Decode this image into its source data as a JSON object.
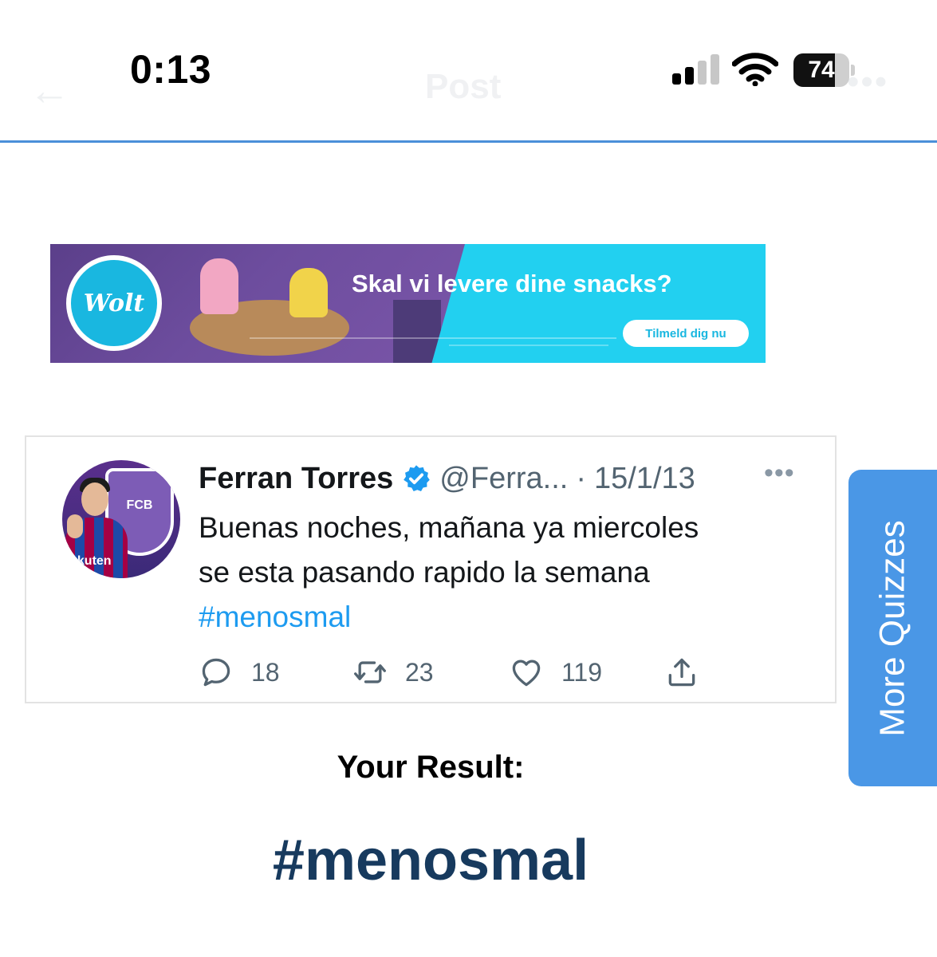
{
  "status_bar": {
    "time": "0:13",
    "battery_level": "74",
    "battery_fraction": 0.74
  },
  "header": {
    "back_icon": "arrow-left-icon",
    "title": "Post",
    "more_icon": "ellipsis-icon",
    "divider_color": "#4a90d9"
  },
  "ad": {
    "brand": "Wolt",
    "headline": "Skal vi levere dine snacks?",
    "cta": "Tilmeld dig nu",
    "accent_color": "#22d0f0"
  },
  "tweet": {
    "author_name": "Ferran Torres",
    "handle": "@Ferra...",
    "separator": "·",
    "date": "15/1/13",
    "text_line1": "Buenas noches, mañana ya miercoles",
    "text_line2": "se esta pasando rapido la semana",
    "hashtag": "#menosmal",
    "avatar_crest_text": "FCB",
    "avatar_sponsor_text": "akuten",
    "replies": "18",
    "retweets": "23",
    "likes": "119",
    "icons": [
      "verified-badge-icon",
      "reply-icon",
      "retweet-icon",
      "like-icon",
      "share-icon",
      "ellipsis-icon"
    ],
    "link_color": "#1d9bf0"
  },
  "result": {
    "label": "Your Result:",
    "value": "#menosmal"
  },
  "side_tab": {
    "label": "More Quizzes",
    "color": "#4a97e6"
  }
}
